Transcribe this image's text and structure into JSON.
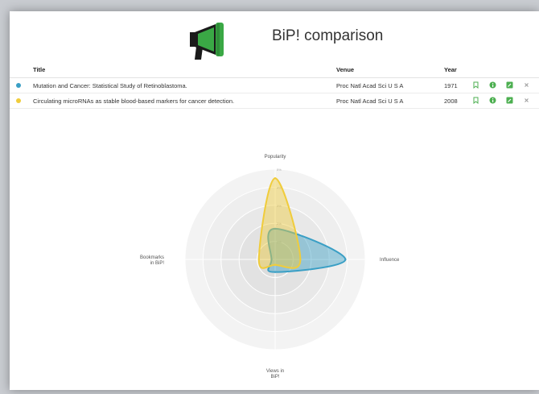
{
  "app": {
    "title": "BiP! comparison"
  },
  "table": {
    "headers": {
      "title": "Title",
      "venue": "Venue",
      "year": "Year"
    },
    "rows": [
      {
        "title": "Mutation and Cancer: Statistical Study of Retinoblastoma.",
        "venue": "Proc Natl Acad Sci U S A",
        "year": "1971",
        "color": "#3a9fc5"
      },
      {
        "title": "Circulating microRNAs as stable blood-based markers for cancer detection.",
        "venue": "Proc Natl Acad Sci U S A",
        "year": "2008",
        "color": "#f0cc3b"
      }
    ],
    "actions": [
      "bookmark-icon",
      "info-icon",
      "edit-icon",
      "close-icon"
    ]
  },
  "chart_data": {
    "type": "radar",
    "axes": [
      "Popularity",
      "Influence",
      "Views in BiP!",
      "Bookmarks in BiP!"
    ],
    "axis_labels": {
      "top": "Popularity",
      "right": "Influence",
      "bottom_line1": "Views in",
      "bottom_line2": "BiP!",
      "left_line1": "Bookmarks",
      "left_line2": "in BiP!"
    },
    "ring_labels": [
      "1%",
      "2%",
      "3%",
      "4%",
      "5%"
    ],
    "range": [
      0,
      5
    ],
    "grid": true,
    "series": [
      {
        "name": "Mutation and Cancer: Statistical Study of Retinoblastoma.",
        "color": "#3a9fc5",
        "values": [
          1.7,
          3.9,
          0.7,
          0.2
        ]
      },
      {
        "name": "Circulating microRNAs as stable blood-based markers for cancer detection.",
        "color": "#f0cc3b",
        "values": [
          4.5,
          1.4,
          0.3,
          0.9
        ]
      }
    ]
  }
}
